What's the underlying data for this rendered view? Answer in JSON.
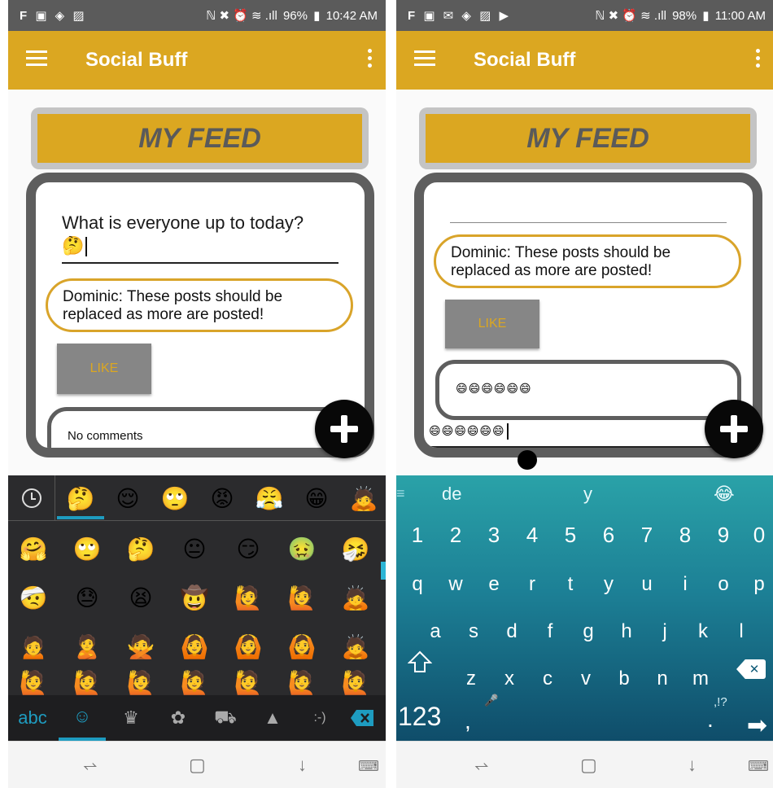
{
  "left": {
    "status": {
      "icons": "F ▣ ◈ ▨",
      "right_icons": "ℕ ✖ ⏰ ≋ .ıll",
      "battery": "96%",
      "time": "10:42 AM"
    },
    "app": {
      "title": "Social Buff"
    },
    "feed": {
      "title": "MY FEED"
    },
    "post": {
      "text": "What is everyone up to today?",
      "emoji": "🤔"
    },
    "bubble": {
      "text": "Dominic: These posts should be replaced as more are posted!"
    },
    "like": {
      "label": "LIKE"
    },
    "comments": {
      "text": "No comments"
    },
    "keyboard": {
      "tab_emojis": [
        "🤔",
        "😌",
        "🙄",
        "😡",
        "😤",
        "😁",
        "🙇"
      ],
      "grid": [
        [
          "🤗",
          "🙄",
          "🤔",
          "😐",
          "😏",
          "🤢",
          "🤧"
        ],
        [
          "🤕",
          "😓",
          "😫",
          "🤠",
          "🙋",
          "🙋",
          "🙇"
        ],
        [
          "🙍",
          "🙎",
          "🙅",
          "🙆",
          "🙆",
          "🙆",
          "🙇"
        ],
        [
          "🙋",
          "🙋",
          "🙋",
          "🙋",
          "🙋",
          "🙋",
          "🙋"
        ]
      ],
      "abc_label": "abc",
      "bottom_icons": [
        "☺",
        "♛",
        "✿",
        "⛟",
        "▲",
        ":-)"
      ]
    }
  },
  "right": {
    "status": {
      "icons": "F ▣ ✉ ◈ ▨ ▶",
      "right_icons": "ℕ ✖ ⏰ ≋ .ıll",
      "battery": "98%",
      "time": "11:00 AM"
    },
    "app": {
      "title": "Social Buff"
    },
    "feed": {
      "title": "MY FEED"
    },
    "bubble": {
      "text": "Dominic: These posts should be replaced as more are posted!"
    },
    "like": {
      "label": "LIKE"
    },
    "emoji_post": "😄😄😄😄😄😄",
    "emoji_input": "😄😄😄😄😄😄",
    "keyboard": {
      "suggestions": [
        "de",
        "y",
        "😂"
      ],
      "numbers": [
        "1",
        "2",
        "3",
        "4",
        "5",
        "6",
        "7",
        "8",
        "9",
        "0"
      ],
      "row1": [
        "q",
        "w",
        "e",
        "r",
        "t",
        "y",
        "u",
        "i",
        "o",
        "p"
      ],
      "row2": [
        "a",
        "s",
        "d",
        "f",
        "g",
        "h",
        "j",
        "k",
        "l"
      ],
      "row3": [
        "z",
        "x",
        "c",
        "v",
        "b",
        "n",
        "m"
      ],
      "key_123": "123",
      "comma": ",",
      "dot": ".",
      "punct_hint": ",!?",
      "delete_glyph": "✕"
    }
  },
  "nav": {
    "recent": "⥋",
    "home": "▢",
    "back": "↓",
    "keyboard": "⌨"
  }
}
